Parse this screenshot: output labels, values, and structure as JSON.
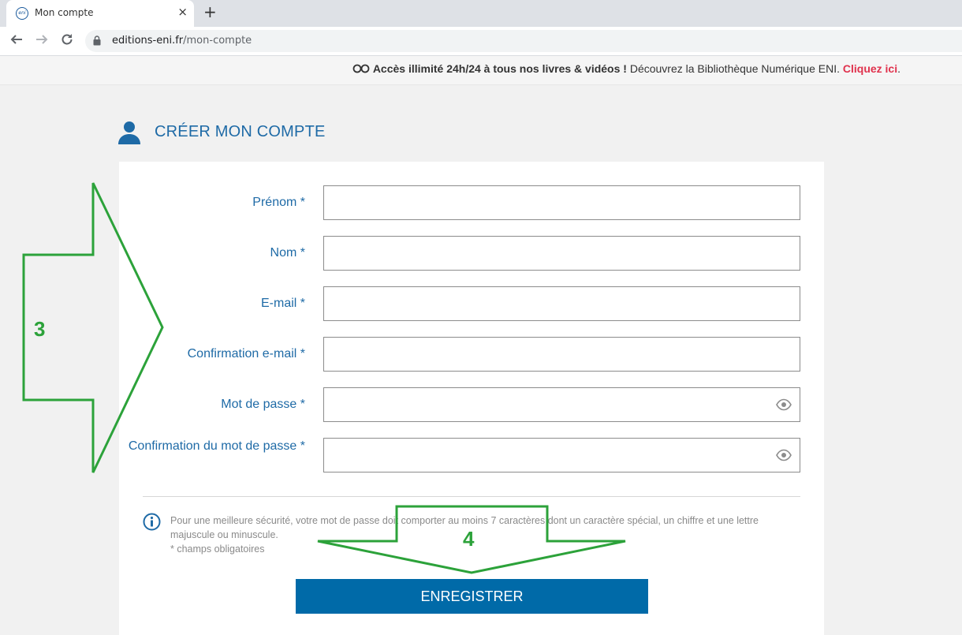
{
  "browser": {
    "tab_title": "Mon compte",
    "tab_favicon_text": "eni",
    "close_glyph": "×",
    "new_tab_glyph": "+",
    "url_host": "editions-eni.fr",
    "url_path": "/mon-compte"
  },
  "promo": {
    "bold_text": "Accès illimité 24h/24 à tous nos livres & vidéos !",
    "text": " Découvrez la Bibliothèque Numérique ENI. ",
    "link_text": "Cliquez ici",
    "trailing": "."
  },
  "page": {
    "title": "CRÉER MON COMPTE"
  },
  "form": {
    "fields": [
      {
        "label": "Prénom *",
        "value": ""
      },
      {
        "label": "Nom *",
        "value": ""
      },
      {
        "label": "E-mail *",
        "value": ""
      },
      {
        "label": "Confirmation e-mail *",
        "value": ""
      },
      {
        "label": "Mot de passe *",
        "value": ""
      },
      {
        "label": "Confirmation du mot de passe *",
        "value": ""
      }
    ],
    "note_line1": "Pour une meilleure sécurité, votre mot de passe doit comporter au moins 7 caractères dont un caractère spécial, un chiffre et une lettre majuscule ou minuscule.",
    "note_line2": "* champs obligatoires",
    "submit_label": "ENREGISTRER"
  },
  "annotations": {
    "arrow_right_label": "3",
    "arrow_down_label": "4",
    "color": "#2ca23a"
  },
  "colors": {
    "accent": "#1e6aa6",
    "button": "#006aa8",
    "promo_link": "#e0324d"
  }
}
